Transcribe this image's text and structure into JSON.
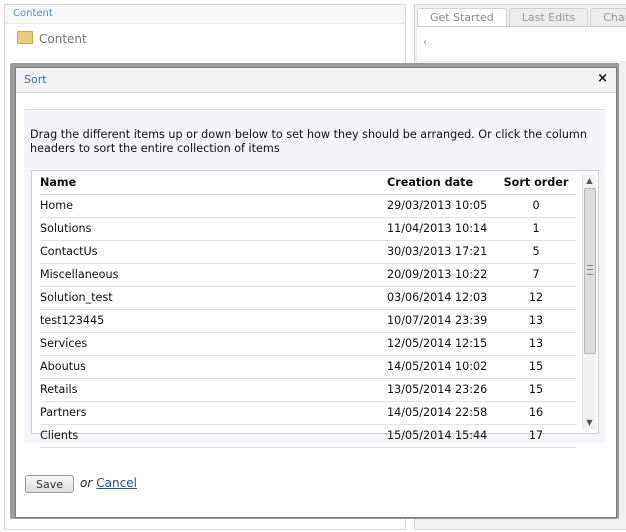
{
  "background": {
    "left_panel": {
      "header": "Content",
      "tree_item": "Content"
    },
    "right_panel": {
      "tabs": [
        "Get Started",
        "Last Edits",
        "Chan"
      ]
    }
  },
  "dialog": {
    "title": "Sort",
    "close_glyph": "×",
    "instructions": "Drag the different items up or down below to set how they should be arranged. Or click the column headers to sort the entire collection of items",
    "columns": {
      "name": "Name",
      "date": "Creation date",
      "sort": "Sort order"
    },
    "rows": [
      {
        "name": "Home",
        "date": "29/03/2013 10:05",
        "sort": "0"
      },
      {
        "name": "Solutions",
        "date": "11/04/2013 10:14",
        "sort": "1"
      },
      {
        "name": "ContactUs",
        "date": "30/03/2013 17:21",
        "sort": "5"
      },
      {
        "name": "Miscellaneous",
        "date": "20/09/2013 10:22",
        "sort": "7"
      },
      {
        "name": "Solution_test",
        "date": "03/06/2014 12:03",
        "sort": "12"
      },
      {
        "name": "test123445",
        "date": "10/07/2014 23:39",
        "sort": "13"
      },
      {
        "name": "Services",
        "date": "12/05/2014 12:15",
        "sort": "13"
      },
      {
        "name": "Aboutus",
        "date": "14/05/2014 10:02",
        "sort": "15"
      },
      {
        "name": "Retails",
        "date": "13/05/2014 23:26",
        "sort": "15"
      },
      {
        "name": "Partners",
        "date": "14/05/2014 22:58",
        "sort": "16"
      },
      {
        "name": "Clients",
        "date": "15/05/2014 15:44",
        "sort": "17"
      }
    ],
    "footer": {
      "save_label": "Save",
      "or_text": "or",
      "cancel_label": "Cancel"
    }
  },
  "icons": {
    "folder": "folder-icon",
    "close": "close-icon",
    "scroll_up": "scroll-up-icon",
    "scroll_down": "scroll-down-icon"
  },
  "colors": {
    "title": "#3b6f8f",
    "link": "#1f4fa8",
    "dialog_body_bg": "#f4f4f9"
  }
}
